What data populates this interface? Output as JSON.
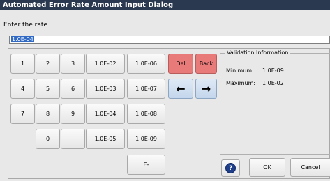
{
  "window": {
    "title": "Automated Error Rate Amount Input Dialog"
  },
  "prompt": "Enter the rate",
  "rate_value": "1.0E-04",
  "keypad": {
    "k1": "1",
    "k2": "2",
    "k3": "3",
    "k4": "4",
    "k5": "5",
    "k6": "6",
    "k7": "7",
    "k8": "8",
    "k9": "9",
    "k0": "0",
    "dot": ".",
    "e02": "1.0E-02",
    "e03": "1.0E-03",
    "e04": "1.0E-04",
    "e05": "1.0E-05",
    "e06": "1.0E-06",
    "e07": "1.0E-07",
    "e08": "1.0E-08",
    "e09": "1.0E-09",
    "del": "Del",
    "back": "Back",
    "e_minus": "E-"
  },
  "validation": {
    "legend": "Validation Information",
    "min_label": "Minimum:",
    "min_value": "1.0E-09",
    "max_label": "Maximum:",
    "max_value": "1.0E-02"
  },
  "buttons": {
    "ok": "OK",
    "cancel": "Cancel"
  },
  "colors": {
    "titlebar": "#2b3950",
    "del_back": "#e87a7a",
    "arrows": "#c4d6ec"
  },
  "icons": {
    "left": "arrow-left-icon",
    "right": "arrow-right-icon",
    "help": "help-icon"
  }
}
